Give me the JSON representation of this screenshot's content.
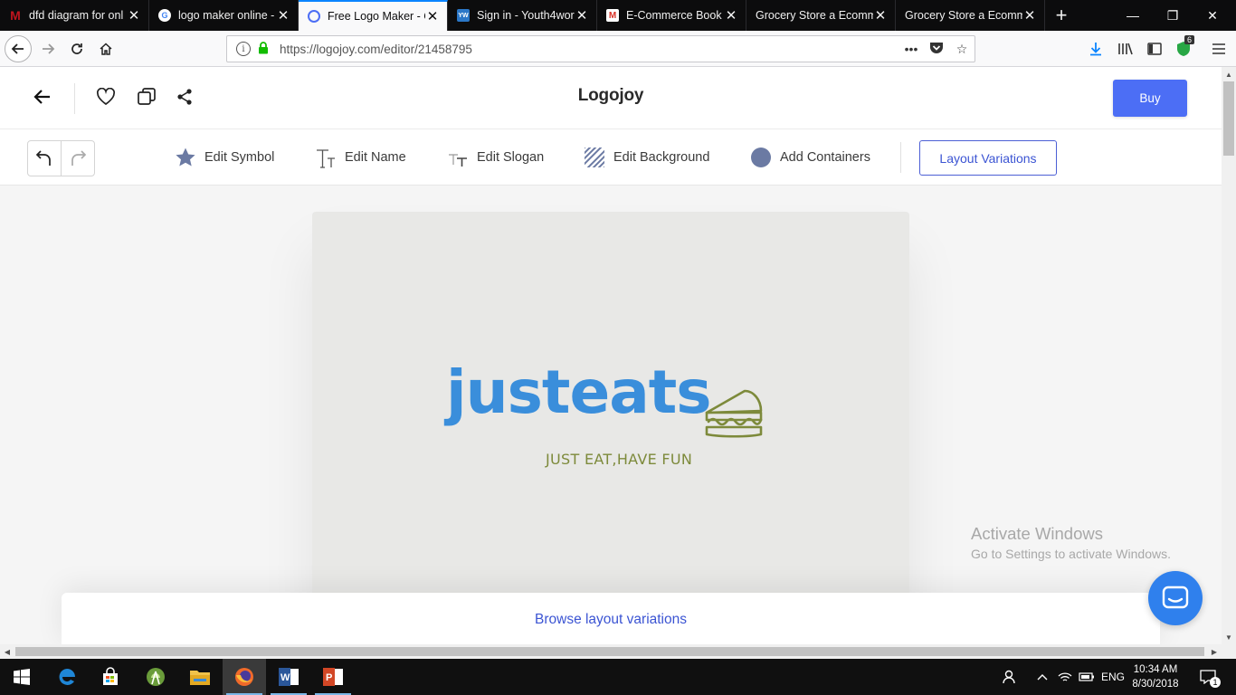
{
  "browser": {
    "tabs": [
      {
        "title": "dfd diagram for onl",
        "icon": "red-m-favicon",
        "color": "#c0151e",
        "active": false
      },
      {
        "title": "logo maker online -",
        "icon": "google-favicon",
        "color": "#4285f4",
        "active": false
      },
      {
        "title": "Free Logo Maker - C",
        "icon": "logojoy-favicon",
        "color": "#4c6ef5",
        "active": true
      },
      {
        "title": "Sign in - Youth4wor",
        "icon": "yw-favicon",
        "color": "#2b77c7",
        "active": false
      },
      {
        "title": "E-Commerce Book",
        "icon": "gmail-favicon",
        "color": "#d93025",
        "active": false
      },
      {
        "title": "Grocery Store a Ecomm",
        "icon": "",
        "color": "",
        "active": false
      },
      {
        "title": "Grocery Store a Ecomm",
        "icon": "",
        "color": "",
        "active": false
      }
    ],
    "new_tab": "+",
    "url": "https://logojoy.com/editor/21458795",
    "addon_badge": "6"
  },
  "app": {
    "brand": "Logojoy",
    "buy_label": "Buy",
    "tools": {
      "edit_symbol": "Edit Symbol",
      "edit_name": "Edit Name",
      "edit_slogan": "Edit Slogan",
      "edit_background": "Edit Background",
      "add_containers": "Add Containers",
      "layout_variations": "Layout Variations"
    },
    "logo": {
      "name": "justeats",
      "slogan": "JUST EAT,HAVE FUN",
      "name_color": "#3a8edb",
      "slogan_color": "#7d8a3b",
      "symbol": "sandwich-icon",
      "background_color": "#e8e8e6"
    },
    "browse_label": "Browse layout variations",
    "accent_color": "#4c6ef5"
  },
  "watermark": {
    "line1": "Activate Windows",
    "line2": "Go to Settings to activate Windows."
  },
  "taskbar": {
    "apps": [
      "windows-start",
      "edge",
      "store",
      "android-studio",
      "file-explorer",
      "firefox",
      "word",
      "powerpoint"
    ],
    "lang": "ENG",
    "time": "10:34 AM",
    "date": "8/30/2018",
    "notification_count": "1"
  }
}
